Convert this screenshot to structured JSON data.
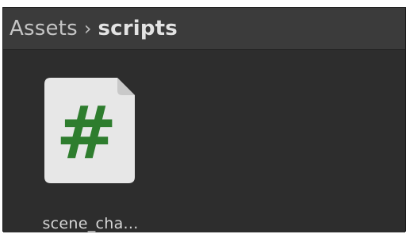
{
  "breadcrumb": {
    "root": "Assets",
    "separator": "›",
    "current": "scripts"
  },
  "assets": [
    {
      "name": "scene_cha...",
      "icon": "csharp-script-icon",
      "glyph": "#",
      "glyph_color": "#2e7d2e"
    }
  ]
}
